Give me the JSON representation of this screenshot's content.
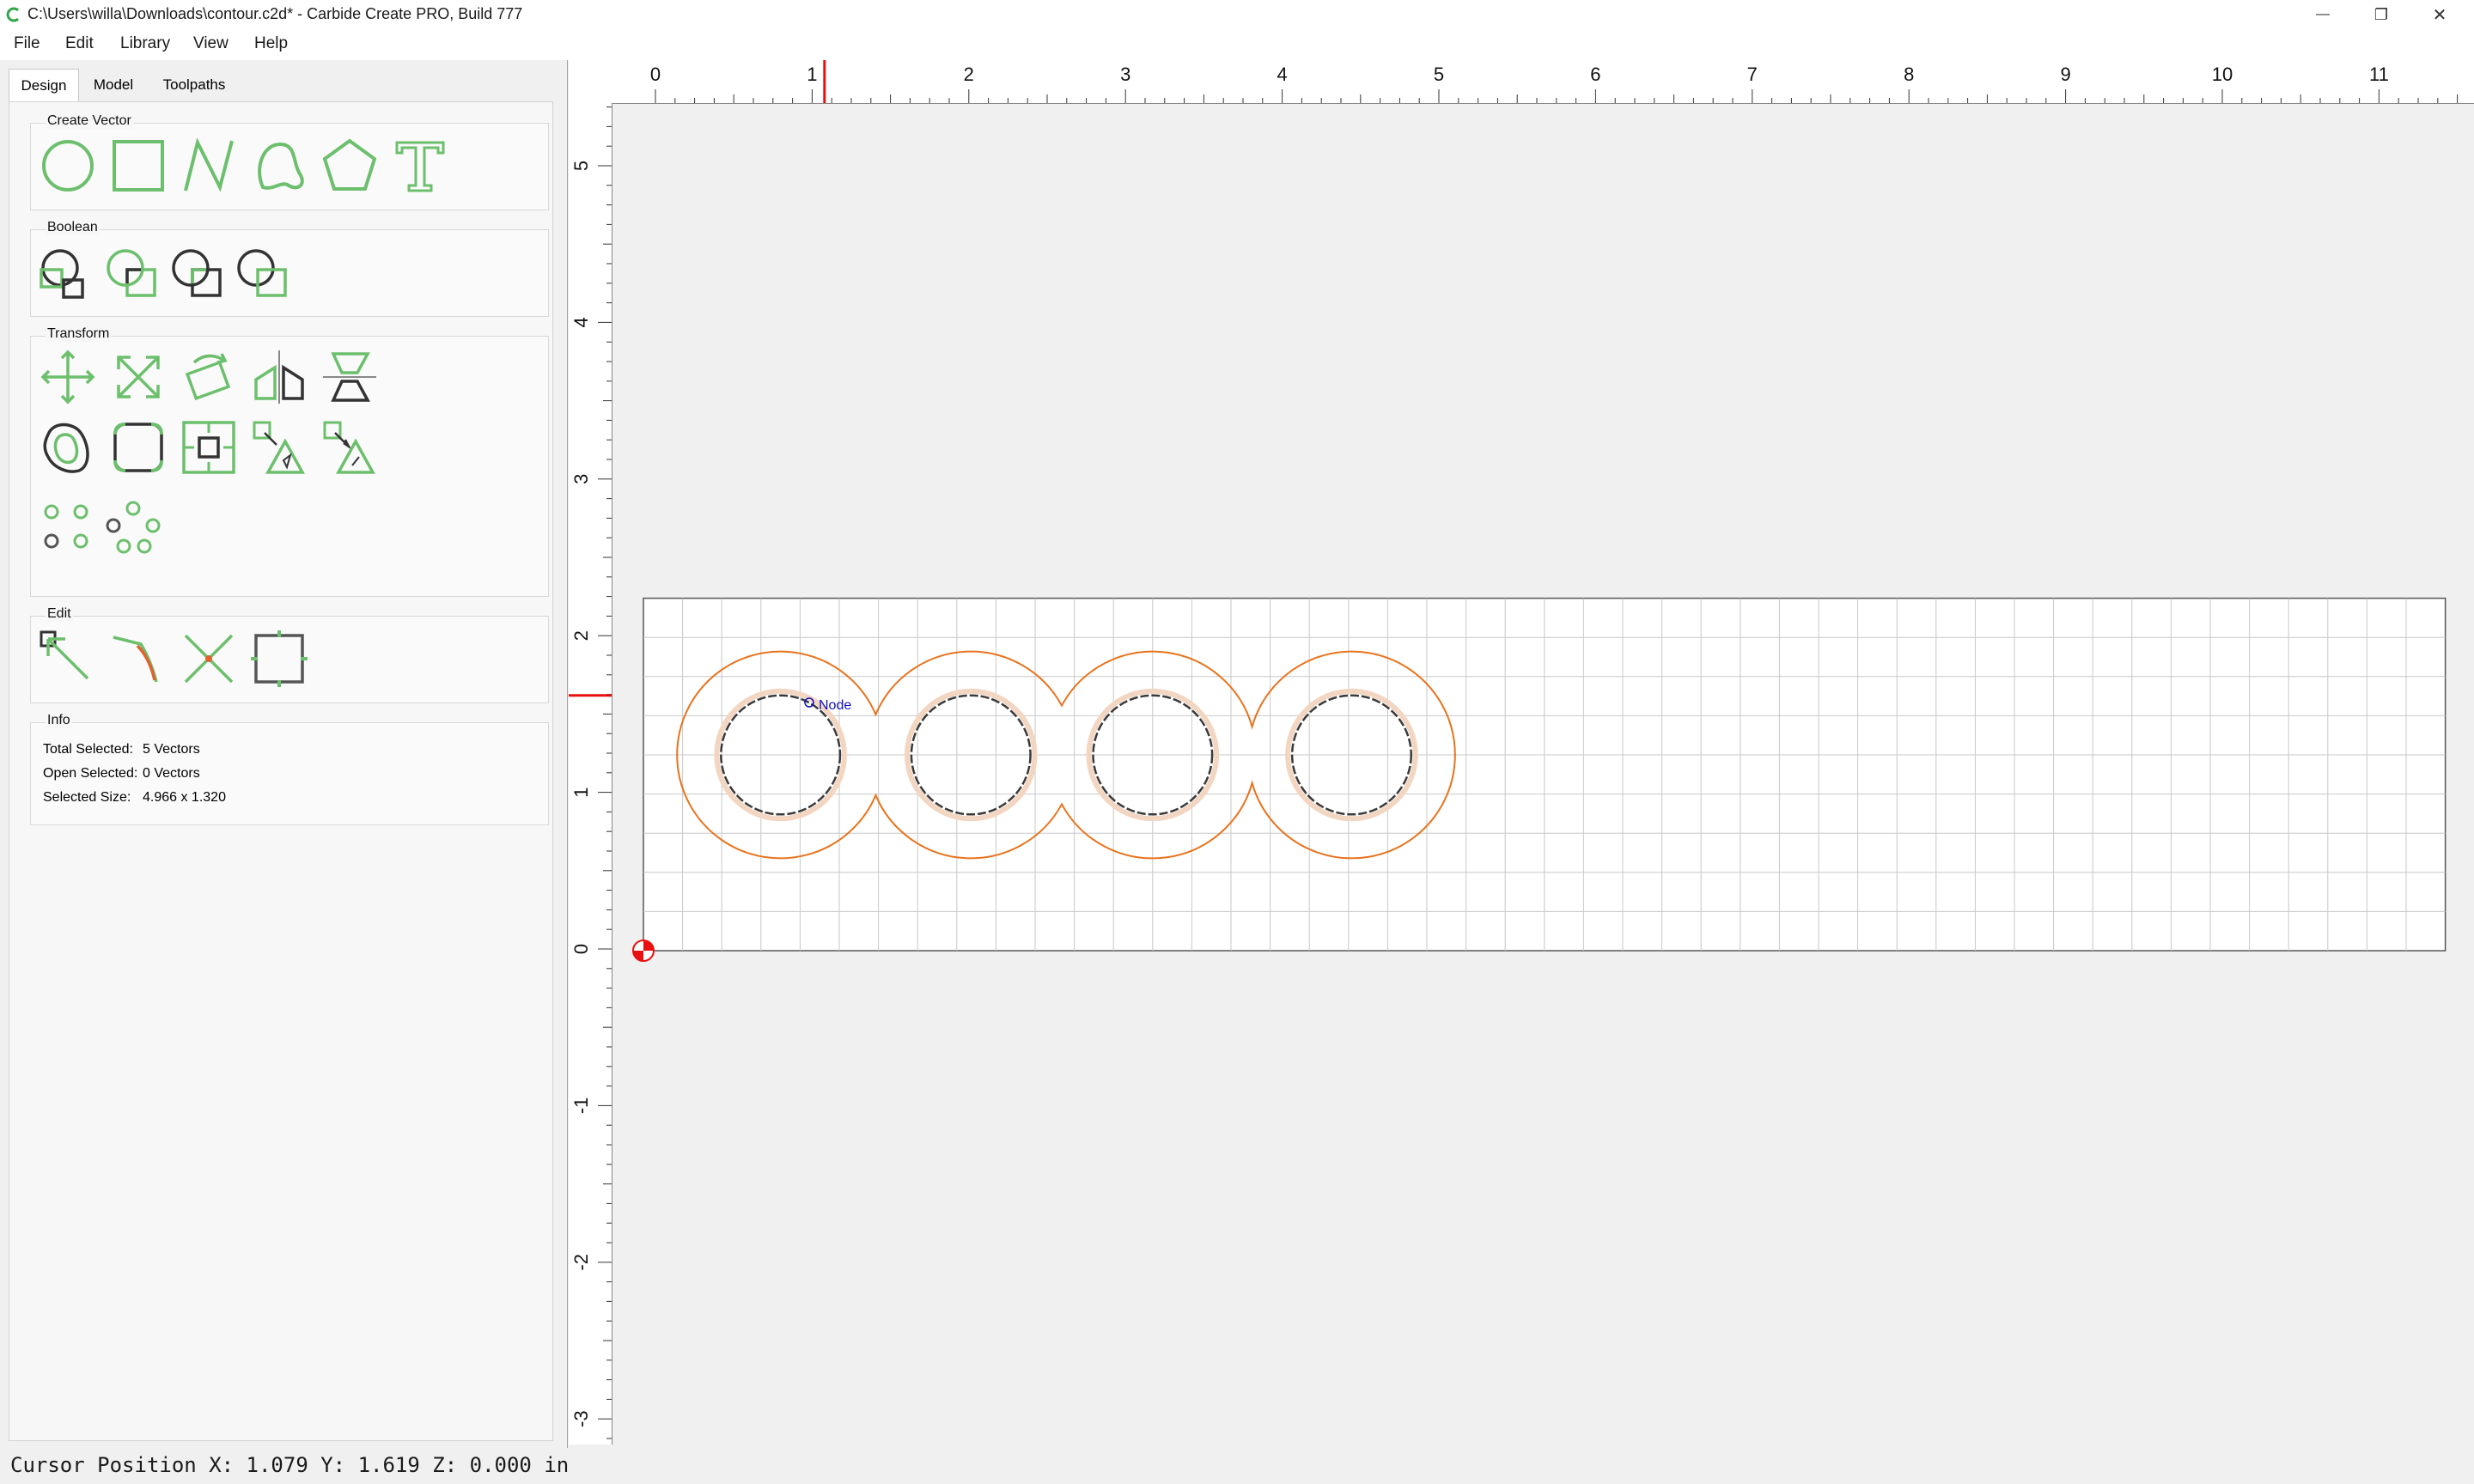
{
  "window": {
    "title": "C:\\Users\\willa\\Downloads\\contour.c2d* - Carbide Create PRO, Build 777",
    "minimize_glyph": "—",
    "maximize_glyph": "❐",
    "close_glyph": "✕"
  },
  "menu": [
    "File",
    "Edit",
    "Library",
    "View",
    "Help"
  ],
  "tabs": [
    "Design",
    "Model",
    "Toolpaths"
  ],
  "groups": {
    "create_vector": "Create Vector",
    "boolean": "Boolean",
    "transform": "Transform",
    "edit": "Edit",
    "info": "Info"
  },
  "icons": {
    "create_vector": [
      "circle-icon",
      "rectangle-icon",
      "polyline-icon",
      "curve-icon",
      "polygon-icon",
      "text-icon"
    ],
    "boolean": [
      "union-icon",
      "subtract-icon",
      "intersect-icon",
      "weld-icon"
    ],
    "transform": [
      "move-icon",
      "scale-icon",
      "rotate-icon",
      "mirror-icon",
      "flip-icon",
      "offset-icon",
      "fillet-icon",
      "align-icon",
      "distribute-icon",
      "array-icon",
      "grid-array-icon",
      "circular-array-icon"
    ],
    "edit": [
      "node-edit-icon",
      "smooth-node-icon",
      "trim-icon",
      "bounding-box-icon"
    ]
  },
  "info": {
    "total_selected_label": "Total Selected:",
    "total_selected_value": "5 Vectors",
    "open_selected_label": "Open Selected:",
    "open_selected_value": "0 Vectors",
    "selected_size_label": "Selected Size:",
    "selected_size_value": "4.966 x 1.320"
  },
  "ruler": {
    "horizontal_labels": [
      "0",
      "1",
      "2",
      "3",
      "4",
      "5",
      "6",
      "7",
      "8",
      "9",
      "10",
      "11"
    ],
    "vertical_labels": [
      "5",
      "4",
      "3",
      "2",
      "1",
      "0",
      "-1",
      "-2",
      "-3"
    ]
  },
  "canvas": {
    "node_tooltip": "Node",
    "stock_width_in": 11.5,
    "stock_height_in": 2.25,
    "cursor_x_in": 1.079,
    "cursor_y_in": 1.619,
    "colors": {
      "offset_contour": "#e8731e",
      "selected_vector": "#3a3a3a",
      "accent": "#6cbf6c",
      "cursor_marker": "#e81010"
    }
  },
  "status": {
    "cursor_position": "Cursor Position X: 1.079 Y: 1.619 Z: 0.000 in"
  }
}
